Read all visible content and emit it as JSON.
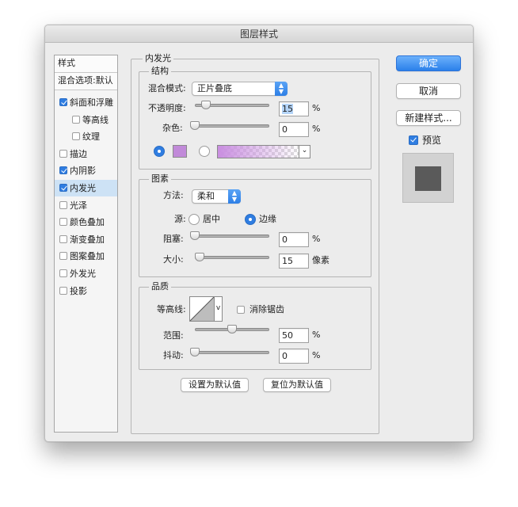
{
  "window": {
    "title": "图层样式"
  },
  "style_list": {
    "header": "样式",
    "blend_options": "混合选项:默认",
    "items": [
      {
        "label": "斜面和浮雕",
        "checked": true,
        "sub": false,
        "selected": false
      },
      {
        "label": "等高线",
        "checked": false,
        "sub": true,
        "selected": false
      },
      {
        "label": "纹理",
        "checked": false,
        "sub": true,
        "selected": false
      },
      {
        "label": "描边",
        "checked": false,
        "sub": false,
        "selected": false
      },
      {
        "label": "内阴影",
        "checked": true,
        "sub": false,
        "selected": false
      },
      {
        "label": "内发光",
        "checked": true,
        "sub": false,
        "selected": true
      },
      {
        "label": "光泽",
        "checked": false,
        "sub": false,
        "selected": false
      },
      {
        "label": "颜色叠加",
        "checked": false,
        "sub": false,
        "selected": false
      },
      {
        "label": "渐变叠加",
        "checked": false,
        "sub": false,
        "selected": false
      },
      {
        "label": "图案叠加",
        "checked": false,
        "sub": false,
        "selected": false
      },
      {
        "label": "外发光",
        "checked": false,
        "sub": false,
        "selected": false
      },
      {
        "label": "投影",
        "checked": false,
        "sub": false,
        "selected": false
      }
    ]
  },
  "panel": {
    "title": "内发光",
    "structure": {
      "title": "结构",
      "blend_mode_label": "混合模式:",
      "blend_mode_value": "正片叠底",
      "opacity_label": "不透明度:",
      "opacity_value": "15",
      "opacity_level": 15,
      "noise_label": "杂色:",
      "noise_value": "0",
      "noise_level": 0,
      "percent": "%",
      "color_swatch": "#c18ad9",
      "gradient_color": "#c98ee0",
      "color_radio_selected": true
    },
    "elements": {
      "title": "图素",
      "technique_label": "方法:",
      "technique_value": "柔和",
      "source_label": "源:",
      "source_center": "居中",
      "source_edge": "边缘",
      "source_selected": "edge",
      "choke_label": "阻塞:",
      "choke_value": "0",
      "choke_level": 0,
      "size_label": "大小:",
      "size_value": "15",
      "size_level": 6,
      "size_unit": "像素",
      "percent": "%"
    },
    "quality": {
      "title": "品质",
      "contour_label": "等高线:",
      "antialias_label": "消除锯齿",
      "antialias_checked": false,
      "range_label": "范围:",
      "range_value": "50",
      "range_level": 50,
      "jitter_label": "抖动:",
      "jitter_value": "0",
      "jitter_level": 0,
      "percent": "%"
    },
    "make_default": "设置为默认值",
    "reset_default": "复位为默认值"
  },
  "buttons": {
    "ok": "确定",
    "cancel": "取消",
    "new_style": "新建样式...",
    "preview_label": "预览",
    "preview_checked": true
  },
  "colors": {
    "accent": "#2f7de1",
    "preview_swatch": "#5a5a5a"
  }
}
